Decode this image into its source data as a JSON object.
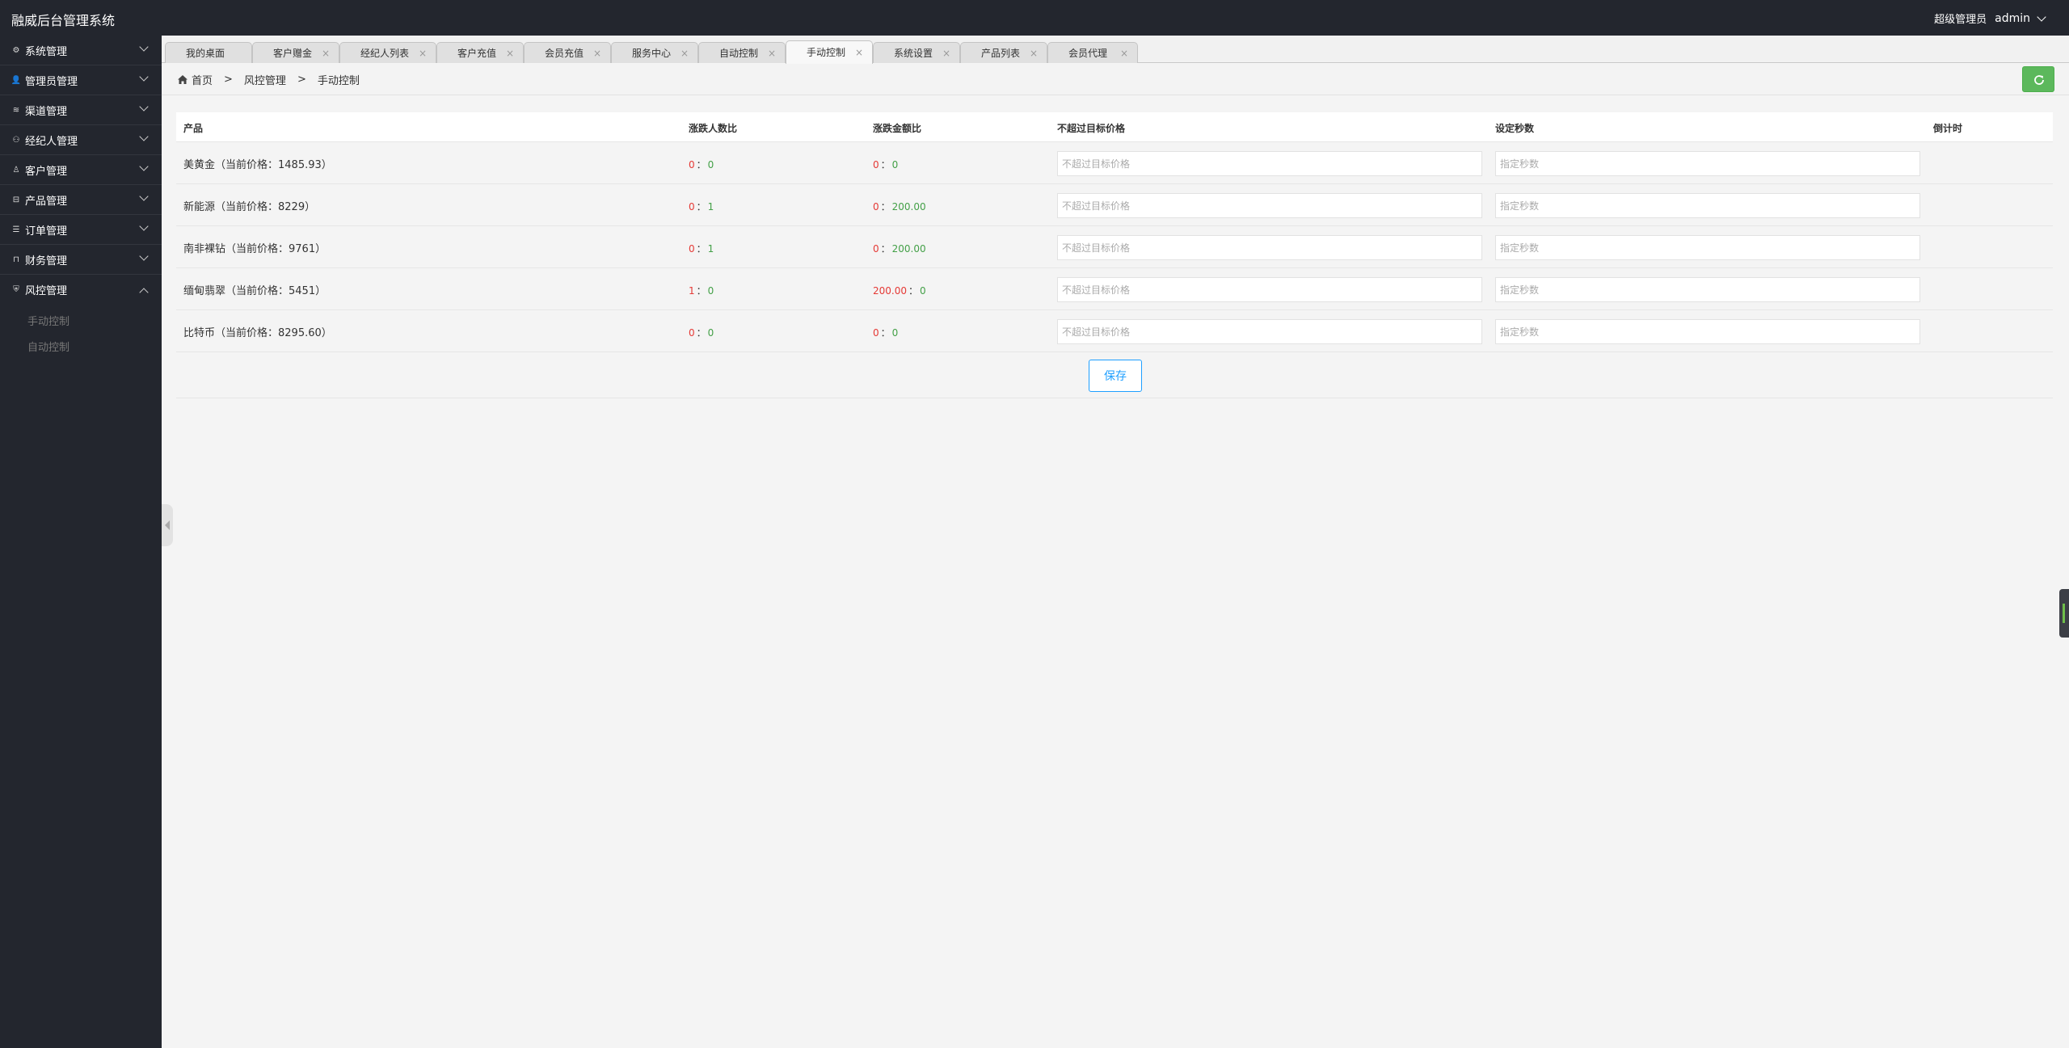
{
  "app": {
    "title": "融威后台管理系统"
  },
  "user": {
    "role": "超级管理员",
    "name": "admin"
  },
  "sidebar": {
    "items": [
      {
        "label": "系统管理",
        "icon": "gear-icon",
        "glyph": "⚙"
      },
      {
        "label": "管理员管理",
        "icon": "person-icon",
        "glyph": "👤"
      },
      {
        "label": "渠道管理",
        "icon": "channel-icon",
        "glyph": "≋"
      },
      {
        "label": "经纪人管理",
        "icon": "broker-icon",
        "glyph": "⚇"
      },
      {
        "label": "客户管理",
        "icon": "customer-icon",
        "glyph": "♙"
      },
      {
        "label": "产品管理",
        "icon": "product-icon",
        "glyph": "⊟"
      },
      {
        "label": "订单管理",
        "icon": "order-icon",
        "glyph": "☰"
      },
      {
        "label": "财务管理",
        "icon": "lock-icon",
        "glyph": "⊓"
      },
      {
        "label": "风控管理",
        "icon": "shield-icon",
        "glyph": "⛨"
      }
    ],
    "sub_items": [
      "手动控制",
      "自动控制"
    ]
  },
  "tabs": [
    {
      "label": "我的桌面"
    },
    {
      "label": "客户赠金",
      "close": "×"
    },
    {
      "label": "经纪人列表",
      "close": "×"
    },
    {
      "label": "客户充值",
      "close": "×"
    },
    {
      "label": "会员充值",
      "close": "×"
    },
    {
      "label": "服务中心",
      "close": "×"
    },
    {
      "label": "自动控制",
      "close": "×"
    },
    {
      "label": "手动控制",
      "close": "×",
      "active": true
    },
    {
      "label": "系统设置",
      "close": "×"
    },
    {
      "label": "产品列表",
      "close": "×"
    },
    {
      "label": "会员代理",
      "close": "×"
    }
  ],
  "breadcrumb": {
    "home": "首页",
    "sep": ">",
    "level1": "风控管理",
    "level2": "手动控制"
  },
  "table": {
    "headers": [
      "产品",
      "涨跌人数比",
      "涨跌金额比",
      "不超过目标价格",
      "设定秒数",
      "倒计时"
    ],
    "rows": [
      {
        "name": "美黄金（当前价格：1485.93）",
        "count_up": "0",
        "count_down": "0",
        "amount_up": "0",
        "amount_down": "0"
      },
      {
        "name": "新能源（当前价格：8229）",
        "count_up": "0",
        "count_down": "1",
        "amount_up": "0",
        "amount_down": "200.00"
      },
      {
        "name": "南非裸钻（当前价格：9761）",
        "count_up": "0",
        "count_down": "1",
        "amount_up": "0",
        "amount_down": "200.00"
      },
      {
        "name": "缅甸翡翠（当前价格：5451）",
        "count_up": "1",
        "count_down": "0",
        "amount_up": "200.00",
        "amount_down": "0"
      },
      {
        "name": "比特币（当前价格：8295.60）",
        "count_up": "0",
        "count_down": "0",
        "amount_up": "0",
        "amount_down": "0"
      }
    ],
    "colon": "：",
    "price_placeholder": "不超过目标价格",
    "seconds_placeholder": "指定秒数"
  },
  "save_label": "保存",
  "colors": {
    "up": "#e53935",
    "down": "#43a047",
    "accent": "#1e9fff",
    "refresh": "#5cb85c",
    "sidebar_bg": "#23262e"
  }
}
